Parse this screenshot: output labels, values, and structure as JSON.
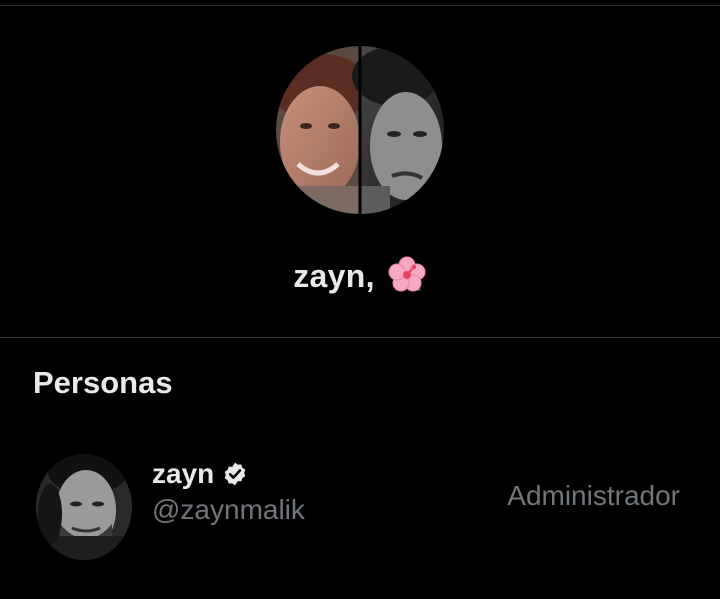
{
  "group": {
    "name": "zayn,",
    "emoji_icon": "hibiscus-flower-icon",
    "avatar": "split-photo-avatar"
  },
  "people_section": {
    "title": "Personas",
    "members": [
      {
        "name": "zayn",
        "handle": "@zaynmalik",
        "role": "Administrador",
        "verified": true,
        "verified_icon": "verified-badge-icon"
      }
    ]
  },
  "colors": {
    "background": "#000000",
    "primary_text": "#e7e9ea",
    "secondary_text": "#71767b",
    "divider": "#2f3336",
    "flower_pink": "#f7a8c4",
    "flower_center": "#e8425f"
  }
}
